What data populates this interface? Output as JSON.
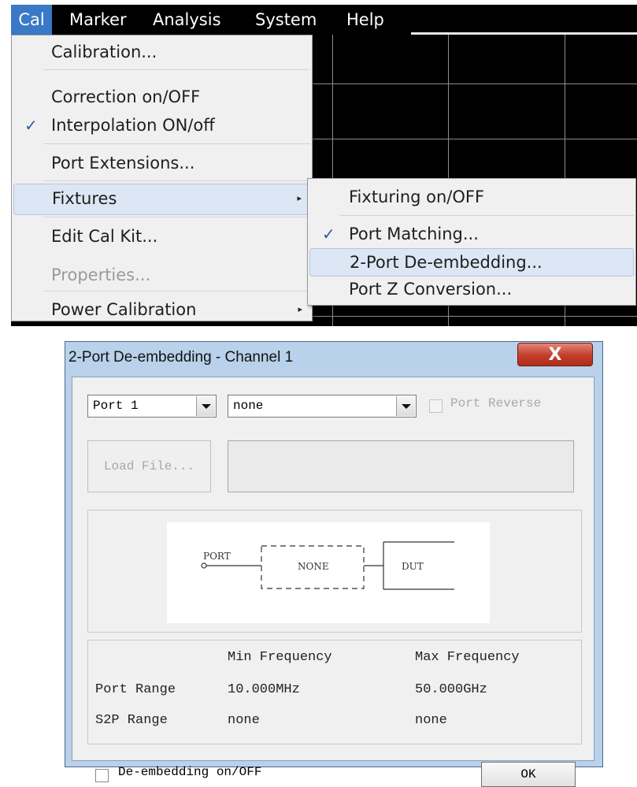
{
  "menubar": {
    "items": [
      "Cal",
      "Marker",
      "Analysis",
      "System",
      "Help"
    ]
  },
  "cal_menu": {
    "items": [
      {
        "label": "Calibration..."
      },
      {
        "label": "Correction on/OFF"
      },
      {
        "label": "Interpolation ON/off",
        "checked": true
      },
      {
        "label": "Port Extensions..."
      },
      {
        "label": "Fixtures",
        "submenu": true,
        "highlighted": true
      },
      {
        "label": "Edit Cal Kit..."
      },
      {
        "label": "Properties...",
        "disabled": true
      },
      {
        "label": "Power Calibration",
        "submenu": true
      }
    ],
    "check_mark": "✓",
    "submenu_arrow": "▸"
  },
  "fixtures_menu": {
    "items": [
      {
        "label": "Fixturing on/OFF"
      },
      {
        "label": "Port Matching...",
        "checked": true
      },
      {
        "label": "2-Port De-embedding...",
        "highlighted": true
      },
      {
        "label": "Port Z Conversion..."
      }
    ]
  },
  "dialog": {
    "title": "2-Port De-embedding - Channel 1",
    "close_glyph": "X",
    "port_select": "Port 1",
    "fixture_select": "none",
    "port_reverse_label": "Port Reverse",
    "port_reverse_checked": false,
    "load_file_label": "Load File...",
    "file_path": "",
    "diagram": {
      "port": "PORT",
      "fixture": "NONE",
      "dut": "DUT"
    },
    "freq_table": {
      "headers": [
        "Min Frequency",
        "Max Frequency"
      ],
      "rows": [
        {
          "label": "Port Range",
          "min": "10.000MHz",
          "max": "50.000GHz"
        },
        {
          "label": "S2P Range",
          "min": "none",
          "max": "none"
        }
      ]
    },
    "deembed_label": "De-embedding on/OFF",
    "deembed_checked": false,
    "ok_label": "OK"
  },
  "colors": {
    "menu_highlight": "#3a78c8",
    "title_bar": "#b9d1ea",
    "close_button": "#c23d2a",
    "display_background": "#000000"
  }
}
